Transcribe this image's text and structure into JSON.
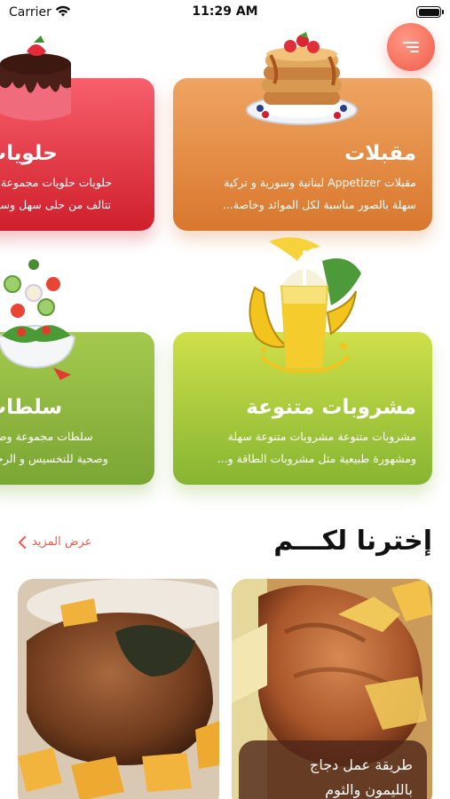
{
  "status_bar": {
    "carrier": "Carrier",
    "time": "11:29 AM"
  },
  "categories": [
    {
      "title": "مقبلات",
      "desc_line1": "مقبلات Appetizer لبنانية وسورية و تركية",
      "desc_line2": "سهلة بالصور مناسبة لكل الموائد وخاصة..."
    },
    {
      "title": "حلويات",
      "desc_line1": "حلويات حلويات مجموعة فر",
      "desc_line2": "تتالف من حلى سهل وسري"
    },
    {
      "title": "مشروبات متنوعة",
      "desc_line1": "مشروبات متنوعة مشروبات متنوعة سهلة",
      "desc_line2": "ومشهورة طبيعية مثل مشروبات الطاقة و..."
    },
    {
      "title": "سلطات",
      "desc_line1": "سلطات مجموعة وصف",
      "desc_line2": "وصحية للتخسيس و الرجيم"
    }
  ],
  "featured": {
    "title": "إخترنا لكـــم",
    "see_more": "عرض المزيد"
  },
  "recipes": [
    {
      "title_line1": "طريقة عمل دجاج",
      "title_line2": "بالليمون والثوم"
    },
    {
      "title_line1": "",
      "title_line2": ""
    }
  ],
  "colors": {
    "accent": "#ec5a4a",
    "appetizers": "#e08a3f",
    "desserts": "#e23a45",
    "drinks": "#a9cc3c",
    "salads": "#8fb840"
  },
  "icons": [
    "wifi-icon",
    "battery-icon",
    "menu-icon",
    "chevron-left-icon"
  ]
}
